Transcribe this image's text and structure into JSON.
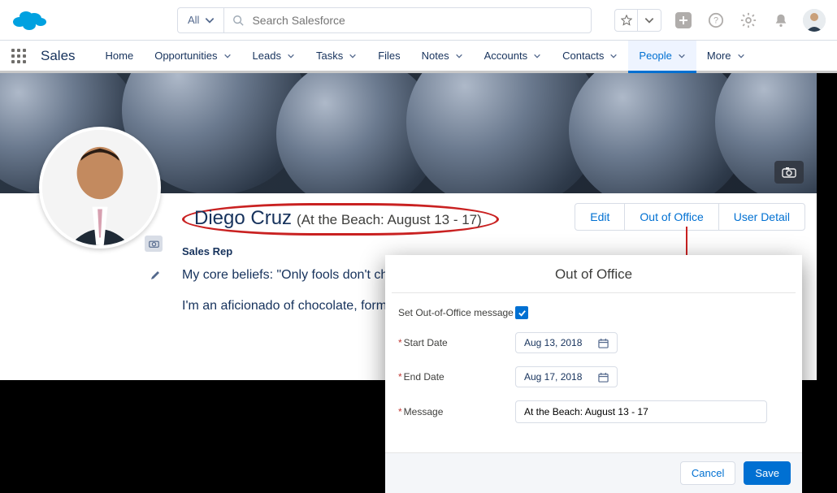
{
  "header": {
    "search_scope": "All",
    "search_placeholder": "Search Salesforce"
  },
  "context": {
    "app_name": "Sales",
    "nav_items": [
      "Home",
      "Opportunities",
      "Leads",
      "Tasks",
      "Files",
      "Notes",
      "Accounts",
      "Contacts",
      "People",
      "More"
    ],
    "nav_dropdown": [
      false,
      true,
      true,
      true,
      false,
      true,
      true,
      true,
      true,
      true
    ],
    "active_index": 8
  },
  "profile": {
    "name": "Diego Cruz",
    "status_suffix": "(At the Beach: August 13 - 17)",
    "role": "Sales Rep",
    "bio_line1": "My core beliefs: \"Only fools don't change their minds\" and \"Business is about people.\"",
    "bio_line2": "I'm an aficionado of chocolate, formaggio, BBQ, and blueberries."
  },
  "actions": {
    "edit": "Edit",
    "ooo": "Out of Office",
    "detail": "User Detail"
  },
  "modal": {
    "title": "Out of Office",
    "set_msg_label": "Set Out-of-Office message",
    "set_msg_checked": true,
    "start_label": "Start Date",
    "start_value": "Aug 13, 2018",
    "end_label": "End Date",
    "end_value": "Aug 17, 2018",
    "message_label": "Message",
    "message_value": "At the Beach: August 13 - 17",
    "cancel": "Cancel",
    "save": "Save"
  }
}
